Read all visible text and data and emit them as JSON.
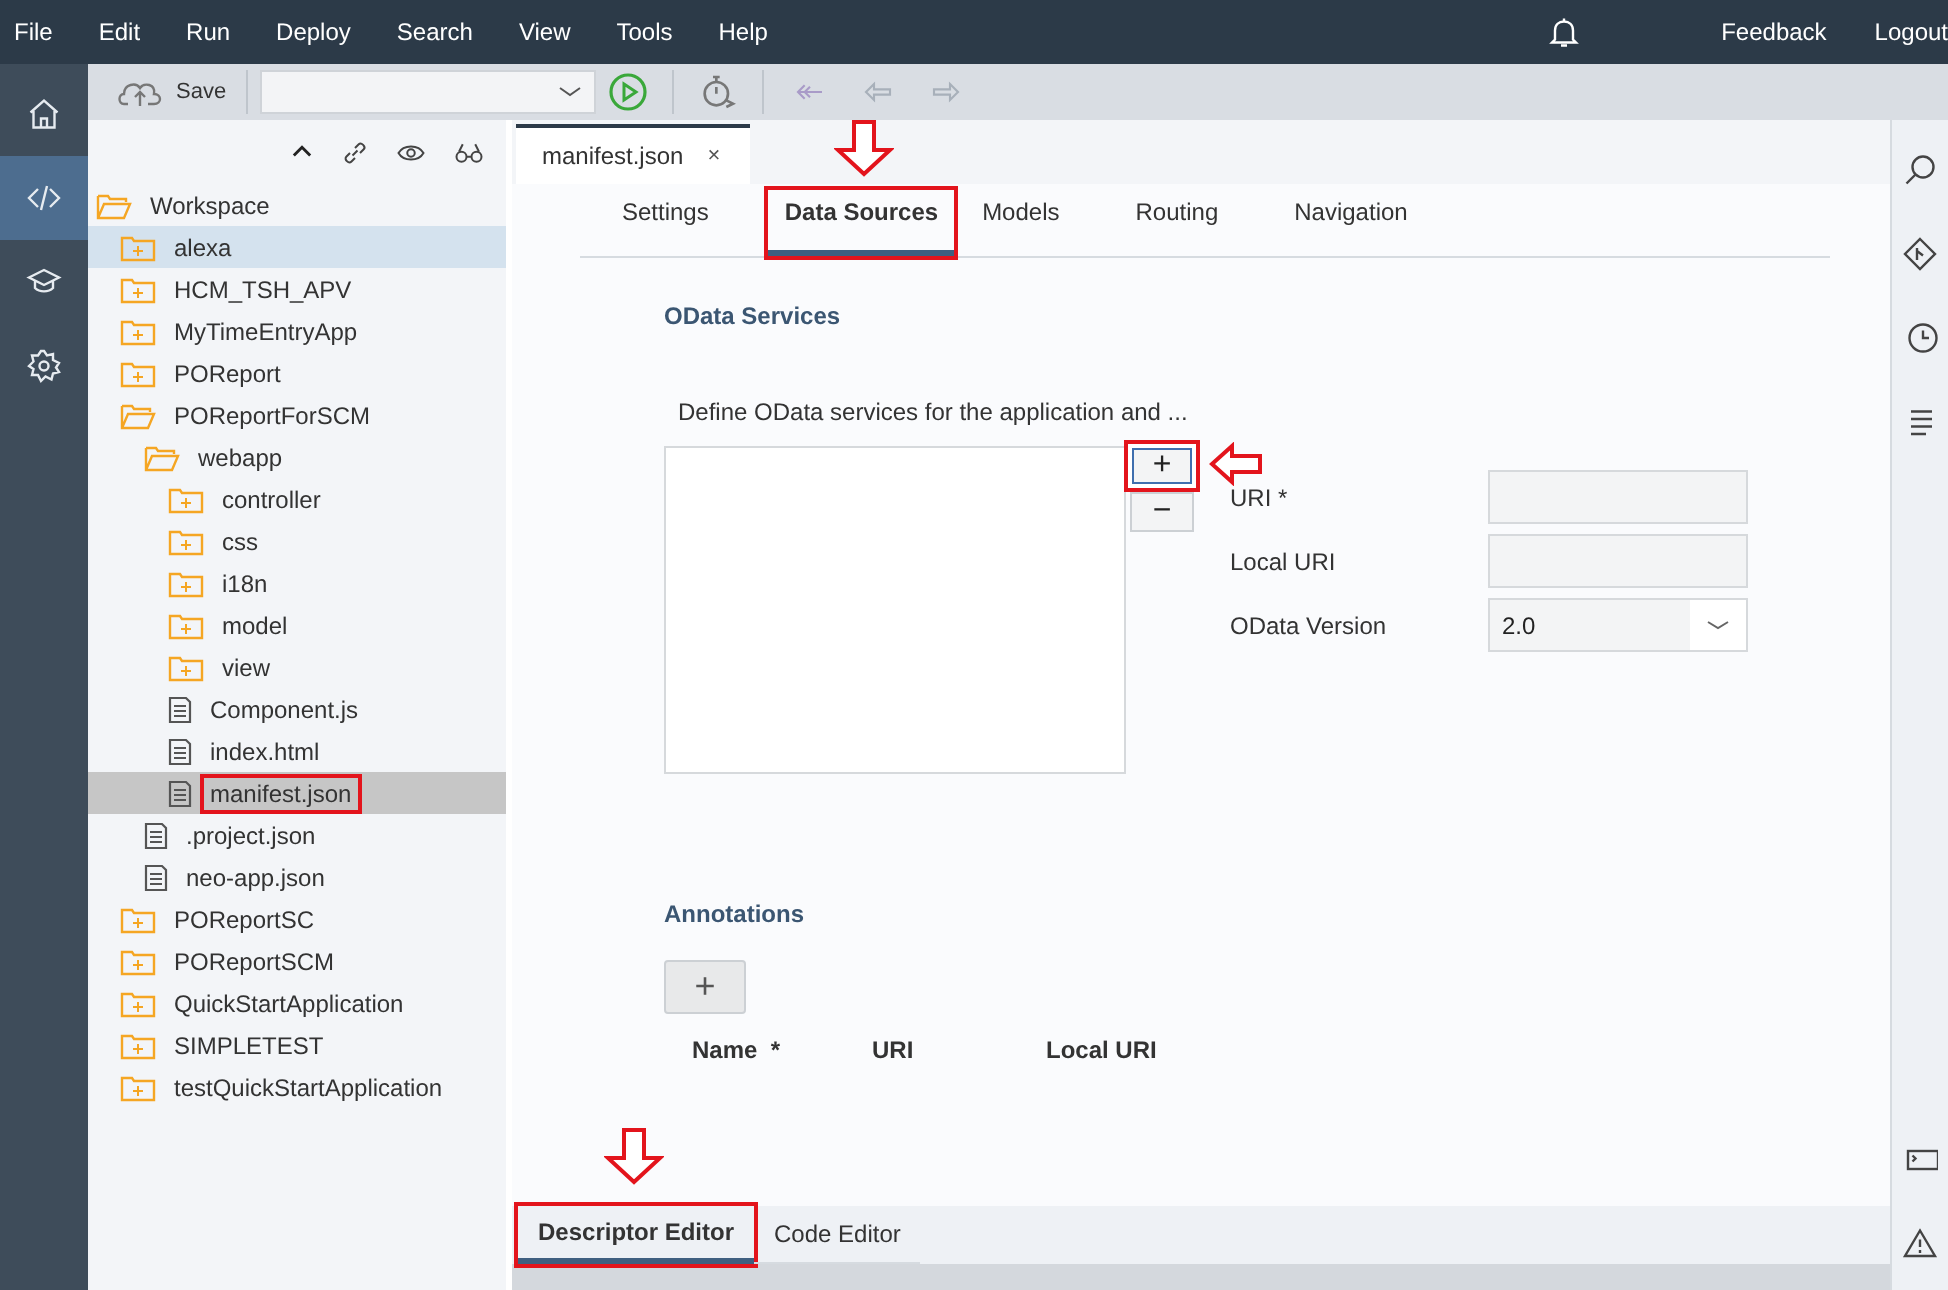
{
  "menu": [
    "File",
    "Edit",
    "Run",
    "Deploy",
    "Search",
    "View",
    "Tools",
    "Help"
  ],
  "header_links": [
    "Feedback",
    "Logout"
  ],
  "side_nav": [
    {
      "kind": "home",
      "selected": false
    },
    {
      "kind": "code",
      "selected": true
    },
    {
      "kind": "learn",
      "selected": false
    },
    {
      "kind": "settings",
      "selected": false
    }
  ],
  "toolbar": {
    "save_label": "Save"
  },
  "tree": [
    {
      "label": "Workspace",
      "kind": "folder",
      "expanded": true,
      "selected": false,
      "hovered": false,
      "marked": false,
      "children": [
        {
          "label": "alexa",
          "kind": "folder",
          "expanded": false,
          "selected": false,
          "hovered": true,
          "marked": false
        },
        {
          "label": "HCM_TSH_APV",
          "kind": "folder",
          "expanded": false,
          "selected": false,
          "hovered": false,
          "marked": false
        },
        {
          "label": "MyTimeEntryApp",
          "kind": "folder",
          "expanded": false,
          "selected": false,
          "hovered": false,
          "marked": false
        },
        {
          "label": "POReport",
          "kind": "folder",
          "expanded": false,
          "selected": false,
          "hovered": false,
          "marked": false
        },
        {
          "label": "POReportForSCM",
          "kind": "folder",
          "expanded": true,
          "selected": false,
          "hovered": false,
          "marked": false,
          "children": [
            {
              "label": "webapp",
              "kind": "folder",
              "expanded": true,
              "selected": false,
              "hovered": false,
              "marked": false,
              "children": [
                {
                  "label": "controller",
                  "kind": "folder",
                  "expanded": false,
                  "selected": false,
                  "hovered": false,
                  "marked": false
                },
                {
                  "label": "css",
                  "kind": "folder",
                  "expanded": false,
                  "selected": false,
                  "hovered": false,
                  "marked": false
                },
                {
                  "label": "i18n",
                  "kind": "folder",
                  "expanded": false,
                  "selected": false,
                  "hovered": false,
                  "marked": false
                },
                {
                  "label": "model",
                  "kind": "folder",
                  "expanded": false,
                  "selected": false,
                  "hovered": false,
                  "marked": false
                },
                {
                  "label": "view",
                  "kind": "folder",
                  "expanded": false,
                  "selected": false,
                  "hovered": false,
                  "marked": false
                },
                {
                  "label": "Component.js",
                  "kind": "file",
                  "selected": false,
                  "hovered": false,
                  "marked": false
                },
                {
                  "label": "index.html",
                  "kind": "file",
                  "selected": false,
                  "hovered": false,
                  "marked": false
                },
                {
                  "label": "manifest.json",
                  "kind": "file",
                  "selected": true,
                  "hovered": false,
                  "marked": true
                }
              ]
            },
            {
              "label": ".project.json",
              "kind": "file",
              "selected": false,
              "hovered": false,
              "marked": false
            },
            {
              "label": "neo-app.json",
              "kind": "file",
              "selected": false,
              "hovered": false,
              "marked": false
            }
          ]
        },
        {
          "label": "POReportSC",
          "kind": "folder",
          "expanded": false,
          "selected": false,
          "hovered": false,
          "marked": false
        },
        {
          "label": "POReportSCM",
          "kind": "folder",
          "expanded": false,
          "selected": false,
          "hovered": false,
          "marked": false
        },
        {
          "label": "QuickStartApplication",
          "kind": "folder",
          "expanded": false,
          "selected": false,
          "hovered": false,
          "marked": false
        },
        {
          "label": "SIMPLETEST",
          "kind": "folder",
          "expanded": false,
          "selected": false,
          "hovered": false,
          "marked": false
        },
        {
          "label": "testQuickStartApplication",
          "kind": "folder",
          "expanded": false,
          "selected": false,
          "hovered": false,
          "marked": false
        }
      ]
    }
  ],
  "editor_tabs": [
    {
      "label": "manifest.json",
      "close": "×",
      "selected": true
    }
  ],
  "sub_tabs": [
    {
      "label": "Settings",
      "selected": false,
      "marked": false,
      "arrow": false
    },
    {
      "label": "Data Sources",
      "selected": true,
      "marked": true,
      "arrow": true
    },
    {
      "label": "Models",
      "selected": false,
      "marked": false,
      "arrow": false
    },
    {
      "label": "Routing",
      "selected": false,
      "marked": false,
      "arrow": false
    },
    {
      "label": "Navigation",
      "selected": false,
      "marked": false,
      "arrow": false
    }
  ],
  "odata": {
    "title": "OData Services",
    "description": "Define OData services for the application and ...",
    "add": {
      "label": "+",
      "marked": true,
      "arrow": true
    },
    "remove": "−",
    "fields": [
      {
        "label": "URI *",
        "kind": "text"
      },
      {
        "label": "Local URI",
        "kind": "text"
      },
      {
        "label": "OData Version",
        "kind": "select",
        "value": "2.0"
      }
    ]
  },
  "annotations": {
    "title": "Annotations",
    "add": "+",
    "columns": [
      "Name  *",
      "URI",
      "Local URI"
    ]
  },
  "bottom_tabs": [
    {
      "label": "Descriptor Editor",
      "selected": true,
      "marked": true,
      "arrow": true
    },
    {
      "label": "Code Editor",
      "selected": false,
      "marked": false,
      "arrow": false
    }
  ]
}
